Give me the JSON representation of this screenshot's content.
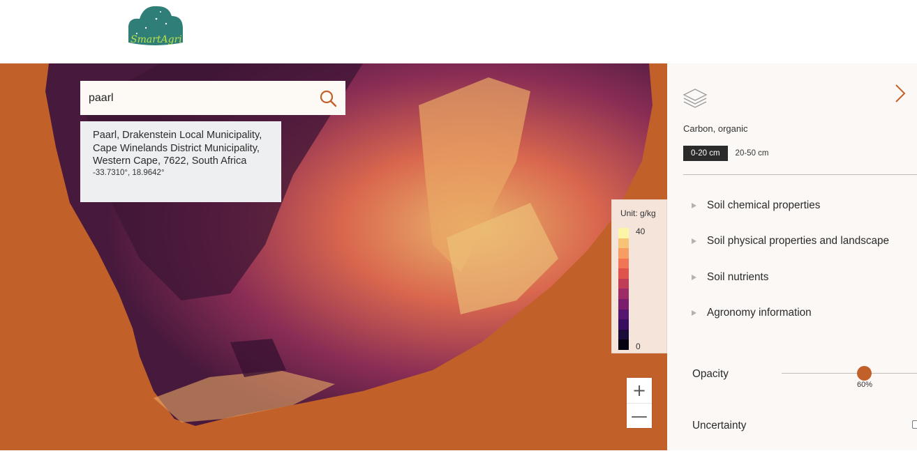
{
  "logo": {
    "text": "SmartAgri"
  },
  "search": {
    "value": "paarl",
    "placeholder": ""
  },
  "result": {
    "address": "Paarl, Drakenstein Local Municipality, Cape Winelands District Municipality, Western Cape, 7622, South Africa",
    "coordinates": "-33.7310°, 18.9642°"
  },
  "legend": {
    "unit": "Unit: g/kg",
    "max": "40",
    "min": "0",
    "colors": [
      "#fdf5a6",
      "#f6c377",
      "#f79d63",
      "#f17655",
      "#e0524c",
      "#c03c57",
      "#9d2b67",
      "#7b1d6d",
      "#561670",
      "#3a0e5e",
      "#1b0b38",
      "#050312"
    ]
  },
  "map": {
    "background": "#c2602a",
    "land_dark": "#47193c",
    "land_mid": "#8a2d55",
    "land_bright": "#e7b56a"
  },
  "zoom": {
    "in": "+",
    "out": "—"
  },
  "panel": {
    "layer_name": "Carbon, organic",
    "tabs": [
      {
        "label": "0-20 cm",
        "active": true
      },
      {
        "label": "20-50 cm",
        "active": false
      }
    ],
    "categories": [
      "Soil chemical properties",
      "Soil physical properties and landscape",
      "Soil nutrients",
      "Agronomy information"
    ],
    "opacity": {
      "label": "Opacity",
      "value": 0.6,
      "value_text": "60%"
    },
    "uncertainty": {
      "label": "Uncertainty",
      "checked": false
    }
  }
}
